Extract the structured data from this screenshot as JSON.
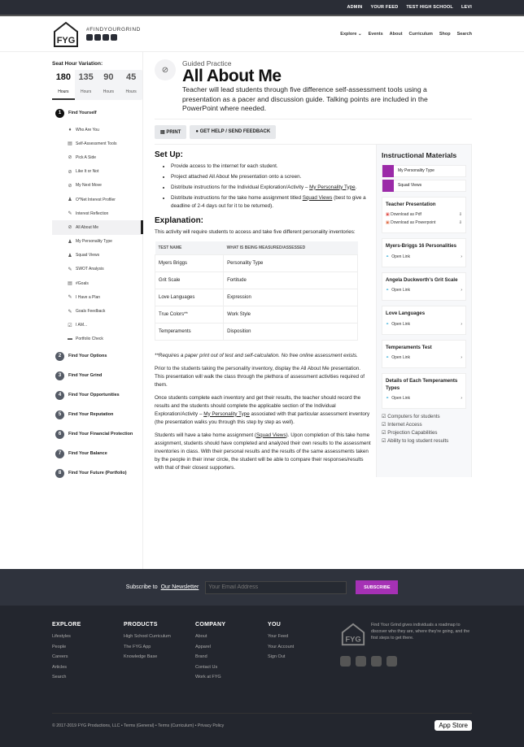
{
  "topbar": {
    "items": [
      "ADMIN",
      "YOUR FEED",
      "TEST HIGH SCHOOL",
      "LEVI"
    ]
  },
  "header": {
    "tagline": "#FINDYOURGRIND",
    "nav": [
      "Explore ⌄",
      "Events",
      "About",
      "Curriculum",
      "Shop",
      "Search"
    ]
  },
  "sidebar": {
    "title": "Seat Hour Variation:",
    "hours": [
      {
        "n": "180",
        "l": "Hours"
      },
      {
        "n": "135",
        "l": "Hours"
      },
      {
        "n": "90",
        "l": "Hours"
      },
      {
        "n": "45",
        "l": "Hours"
      }
    ],
    "step1": "Find Yourself",
    "subs": [
      "Who Are You",
      "Self-Assessment Tools",
      "Pick A Side",
      "Like It or Not",
      "My Next Move",
      "O*Net Interest Profiler",
      "Interest Reflection",
      "All About Me",
      "My Personality Type",
      "Squad Views",
      "SWOT Analysis",
      "#Goals",
      "I Have a Plan",
      "Goals Feedback",
      "I AM...",
      "Portfolio Check"
    ],
    "steps": [
      "Find Your Options",
      "Find Your Grind",
      "Find Your Opportunities",
      "Find Your Reputation",
      "Find Your Financial Protection",
      "Find Your Balance",
      "Find Your Future (Portfolio)"
    ]
  },
  "main": {
    "kicker": "Guided Practice",
    "title": "All About Me",
    "desc": "Teacher will lead students through five difference self-assessment tools using a presentation as a pacer and discussion guide. Talking points are included in the PowerPoint where needed.",
    "print": "PRINT",
    "help": "GET HELP / SEND FEEDBACK",
    "setup_h": "Set Up:",
    "setup": [
      "Provide access to the internet for each student.",
      "Project attached All About Me presentation onto a screen."
    ],
    "setup3a": "Distribute instructions for the Individual Exploration/Activity – ",
    "setup3l": "My Personality Type",
    "setup4a": "Distribute instructions for the take home assignment titled ",
    "setup4l": "Squad Views",
    "setup4b": " (best to give a deadline of 2-4 days out for it to be returned).",
    "expl_h": "Explanation:",
    "expl": "This activity will require students to access and take five different personality inventories:",
    "table": {
      "headers": [
        "TEST NAME",
        "WHAT IS BEING MEASURED/ASSESSED"
      ],
      "rows": [
        [
          "Myers Briggs",
          "Personality Type"
        ],
        [
          "Grit Scale",
          "Fortitude"
        ],
        [
          "Love Languages",
          "Expression"
        ],
        [
          "True Colors**",
          "Work Style"
        ],
        [
          "Temperaments",
          "Disposition"
        ]
      ]
    },
    "note": "**Requires a paper print out of test and self-calculation. No free online assessment exists.",
    "p1": "Prior to the students taking the personality inventory, display the All About Me presentation. This presentation will walk the class through the plethora of assessment activities required of them.",
    "p2a": "Once students complete each inventory and get their results, the teacher should record the results and the students should complete the applicable section of the Individual Exploration/Activity – ",
    "p2l": "My Personality Type",
    "p2b": " associated with that particular assessment inventory (the presentation walks you through this step by step as well).",
    "p3a": "Students will have a take home assignment (",
    "p3l": "Squad Views",
    "p3b": "). Upon completion of this take home assignment, students should have completed and analyzed their own results to the assessment inventories in class. With their personal results and the results of the same assessments taken by the people in their inner circle, the student will be able to compare their responses/results with that of their closest supporters."
  },
  "materials": {
    "title": "Instructional Materials",
    "tags": [
      "My Personality Type",
      "Squad Views"
    ],
    "presentation": {
      "title": "Teacher Presentation",
      "pdf": "Download as Pdf",
      "ppt": "Download as Powerpoint"
    },
    "links": [
      "Myers-Briggs 16 Personalities",
      "Angela Duckworth's Grit Scale",
      "Love Languages",
      "Temperaments Test",
      "Details of Each Temperaments Types"
    ],
    "open": "Open Link",
    "checks": [
      "Computers for students",
      "Internet Access",
      "Projection Capabilities",
      "Ability to log student results"
    ]
  },
  "newsletter": {
    "label": "Subscribe to ",
    "link": "Our Newsletter",
    "placeholder": "Your Email Address",
    "button": "SUBSCRIBE"
  },
  "footer": {
    "cols": [
      {
        "h": "EXPLORE",
        "items": [
          "Lifestyles",
          "People",
          "Careers",
          "Articles",
          "Search"
        ]
      },
      {
        "h": "PRODUCTS",
        "items": [
          "High School Curriculum",
          "The FYG App",
          "Knowledge Base"
        ]
      },
      {
        "h": "COMPANY",
        "items": [
          "About",
          "Apparel",
          "Brand",
          "Contact Us",
          "Work at FYG"
        ]
      },
      {
        "h": "YOU",
        "items": [
          "Your Feed",
          "Your Account",
          "Sign Out"
        ]
      }
    ],
    "about": "Find Your Grind gives individuals a roadmap to discover who they are, where they're going, and the first steps to get there.",
    "copyright": "© 2017-2019 FYG Productions, LLC  •  Terms (General)  •  Terms (Curriculum)  •  Privacy Policy",
    "appstore": "App Store"
  }
}
